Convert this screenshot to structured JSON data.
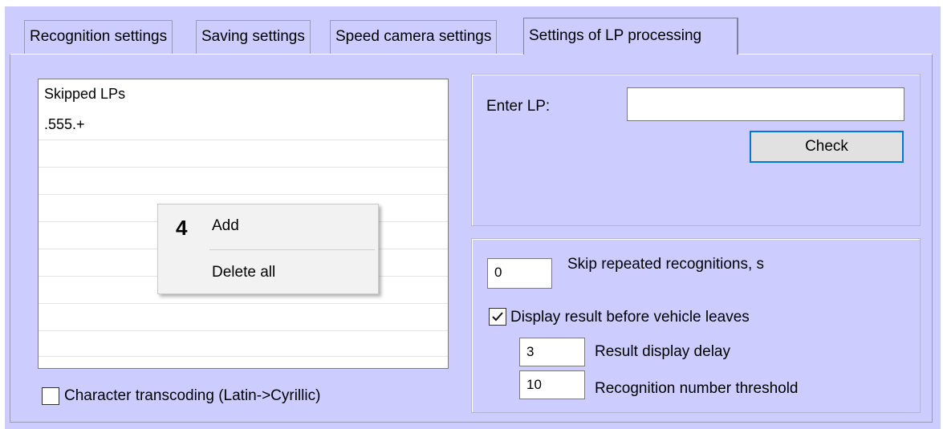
{
  "tabs": [
    {
      "label": "Recognition settings"
    },
    {
      "label": "Saving settings"
    },
    {
      "label": "Speed camera settings"
    },
    {
      "label": "Settings of LP processing",
      "active": true
    }
  ],
  "skipped_list": {
    "header": "Skipped LPs",
    "items": [
      ".555.+"
    ]
  },
  "context_menu": {
    "marker": "4",
    "items": [
      "Add",
      "Delete all"
    ]
  },
  "transcoding": {
    "label": "Character transcoding (Latin->Cyrillic)",
    "checked": false
  },
  "check_group": {
    "enter_label": "Enter LP:",
    "enter_value": "",
    "check_button": "Check"
  },
  "options": {
    "skip_value": "0",
    "skip_label": "Skip repeated recognitions, s",
    "display_label": "Display result before vehicle leaves",
    "display_checked": true,
    "delay_value": "3",
    "delay_label": "Result display delay",
    "threshold_value": "10",
    "threshold_label": "Recognition number threshold"
  }
}
